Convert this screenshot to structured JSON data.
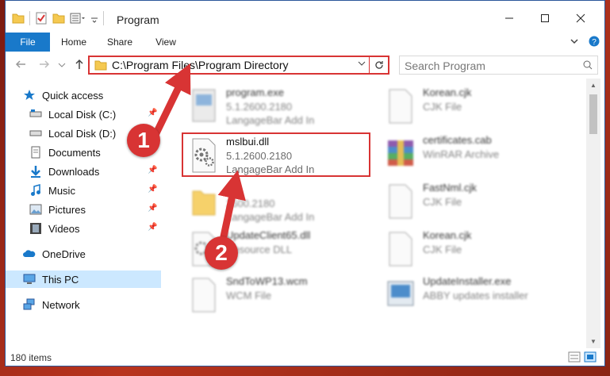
{
  "window": {
    "title": "Program"
  },
  "ribbon": {
    "tabs": [
      "File",
      "Home",
      "Share",
      "View"
    ]
  },
  "address": {
    "path": "C:\\Program Files\\Program Directory",
    "search_placeholder": "Search Program"
  },
  "sidebar": {
    "items": [
      {
        "label": "Quick access",
        "icon": "star-icon",
        "pinned": false
      },
      {
        "label": "Local Disk (C:)",
        "icon": "drive-icon",
        "pinned": true
      },
      {
        "label": "Local Disk (D:)",
        "icon": "drive-icon",
        "pinned": false
      },
      {
        "label": "Documents",
        "icon": "documents-icon",
        "pinned": true
      },
      {
        "label": "Downloads",
        "icon": "downloads-icon",
        "pinned": true
      },
      {
        "label": "Music",
        "icon": "music-icon",
        "pinned": true
      },
      {
        "label": "Pictures",
        "icon": "pictures-icon",
        "pinned": true
      },
      {
        "label": "Videos",
        "icon": "videos-icon",
        "pinned": true
      },
      {
        "label": "OneDrive",
        "icon": "onedrive-icon",
        "pinned": false
      },
      {
        "label": "This PC",
        "icon": "this-pc-icon",
        "pinned": false
      },
      {
        "label": "Network",
        "icon": "network-icon",
        "pinned": false
      }
    ]
  },
  "files": {
    "left": [
      {
        "name": "program.exe",
        "line2": "5.1.2600.2180",
        "line3": "LangageBar Add In",
        "icon": "exe-icon",
        "blurred": true
      },
      {
        "name": "mslbui.dll",
        "line2": "5.1.2600.2180",
        "line3": "LangageBar Add In",
        "icon": "dll-gear-icon",
        "blurred": false
      },
      {
        "name": "",
        "line2": "2600.2180",
        "line3": "LangageBar Add In",
        "icon": "folder-icon",
        "blurred": true
      },
      {
        "name": "UpdateClient65.dll",
        "line2": "Resource DLL",
        "line3": "",
        "icon": "dll-gear-icon",
        "blurred": true
      },
      {
        "name": "SndToWP13.wcm",
        "line2": "WCM File",
        "line3": "",
        "icon": "file-icon",
        "blurred": true
      }
    ],
    "right": [
      {
        "name": "Korean.cjk",
        "line2": "CJK File",
        "icon": "file-icon"
      },
      {
        "name": "certificates.cab",
        "line2": "WinRAR Archive",
        "icon": "winrar-icon"
      },
      {
        "name": "FastNml.cjk",
        "line2": "CJK File",
        "icon": "file-icon"
      },
      {
        "name": "Korean.cjk",
        "line2": "CJK File",
        "icon": "file-icon"
      },
      {
        "name": "UpdateInstaller.exe",
        "line2": "ABBY updates installer",
        "icon": "installer-icon"
      }
    ]
  },
  "status": {
    "count": "180 items"
  },
  "callouts": [
    {
      "label": "1"
    },
    {
      "label": "2"
    }
  ],
  "colors": {
    "accent": "#1979ca",
    "callout": "#d83434",
    "selected": "#cce8ff"
  }
}
